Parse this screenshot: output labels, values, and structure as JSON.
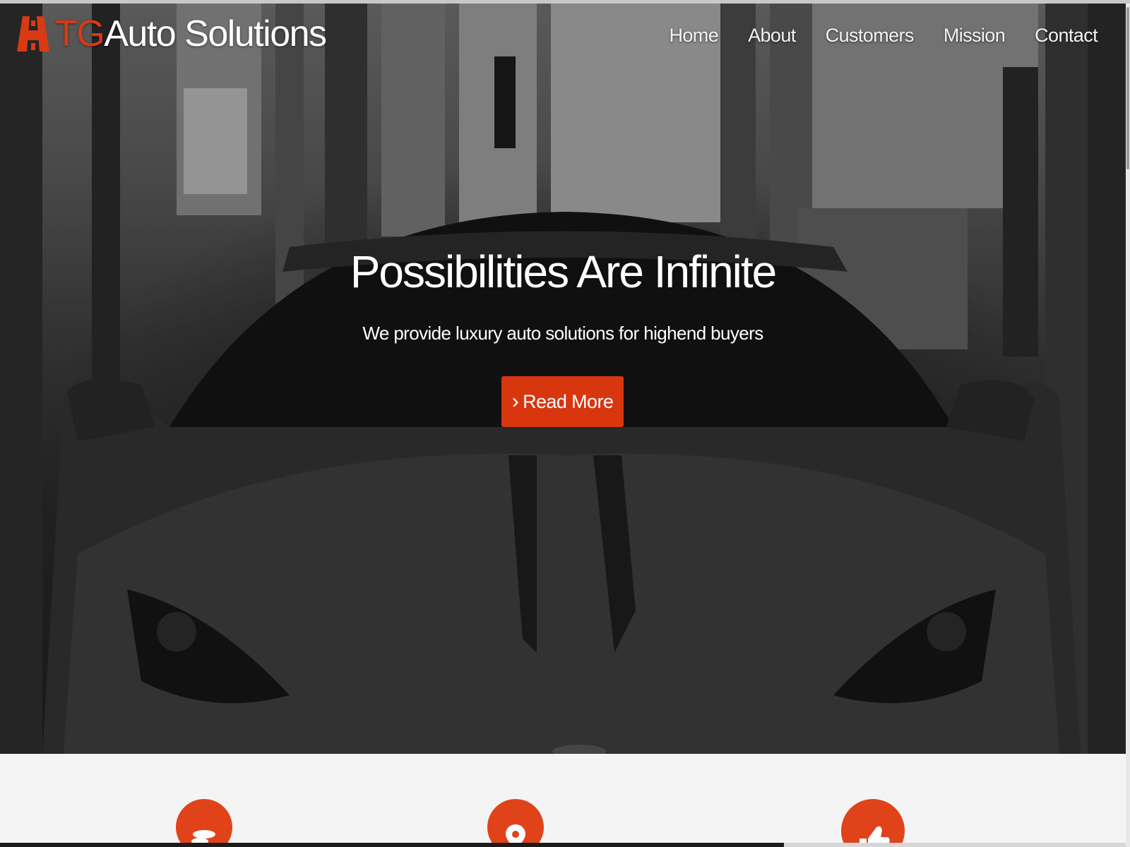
{
  "brand": {
    "logo_icon": "road-lane-icon",
    "name_accent": "TG",
    "name_rest": "Auto Solutions",
    "accent_color": "#d83a14"
  },
  "nav": {
    "items": [
      {
        "label": "Home"
      },
      {
        "label": "About"
      },
      {
        "label": "Customers"
      },
      {
        "label": "Mission"
      },
      {
        "label": "Contact"
      }
    ]
  },
  "hero": {
    "headline": "Possibilities Are Infinite",
    "subline": "We provide luxury auto solutions for highend buyers",
    "cta_icon": "chevron-right-icon",
    "cta_label": "Read More",
    "cta_color": "#d8360f"
  },
  "features": {
    "items": [
      {
        "icon": "coins-icon"
      },
      {
        "icon": "map-pin-icon"
      },
      {
        "icon": "thumbs-up-icon"
      }
    ],
    "icon_color": "#e0431a"
  }
}
